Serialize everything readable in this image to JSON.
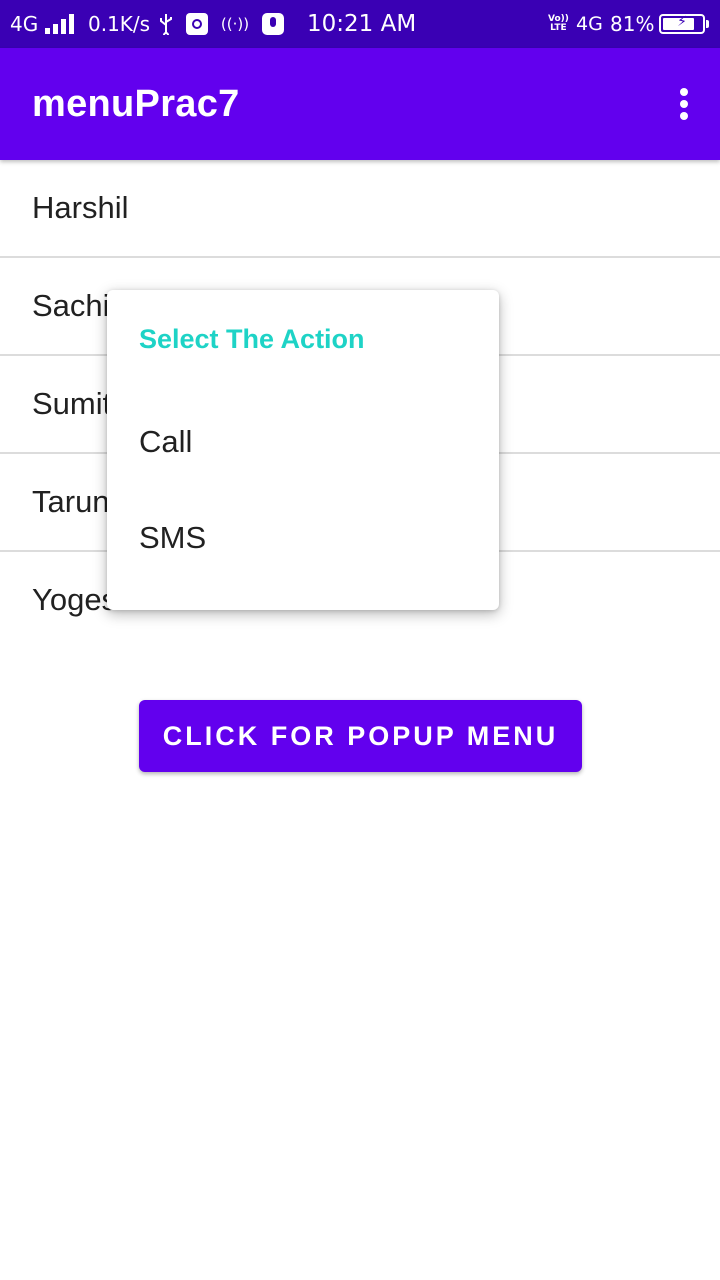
{
  "status_bar": {
    "network": "4G",
    "speed": "0.1K/s",
    "time": "10:21 AM",
    "volte_top": "Vo))",
    "volte_bottom": "LTE",
    "network_right": "4G",
    "battery_percent": "81%",
    "battery_level": 0.81,
    "icons": [
      "signal-icon",
      "usb-icon",
      "debug-icon",
      "hotspot-icon",
      "mic-icon",
      "battery-charging-icon"
    ]
  },
  "app_bar": {
    "title": "menuPrac7",
    "overflow_icon": "more-vert-icon",
    "color": "#6200ee"
  },
  "list": {
    "items": [
      "Harshil",
      "Sachin",
      "Sumit",
      "Tarun",
      "Yogesh"
    ]
  },
  "button": {
    "label": "CLICK FOR POPUP MENU",
    "color": "#6200ee"
  },
  "context_menu": {
    "header": "Select The Action",
    "header_color": "#1ed3c6",
    "items": [
      "Call",
      "SMS"
    ]
  }
}
